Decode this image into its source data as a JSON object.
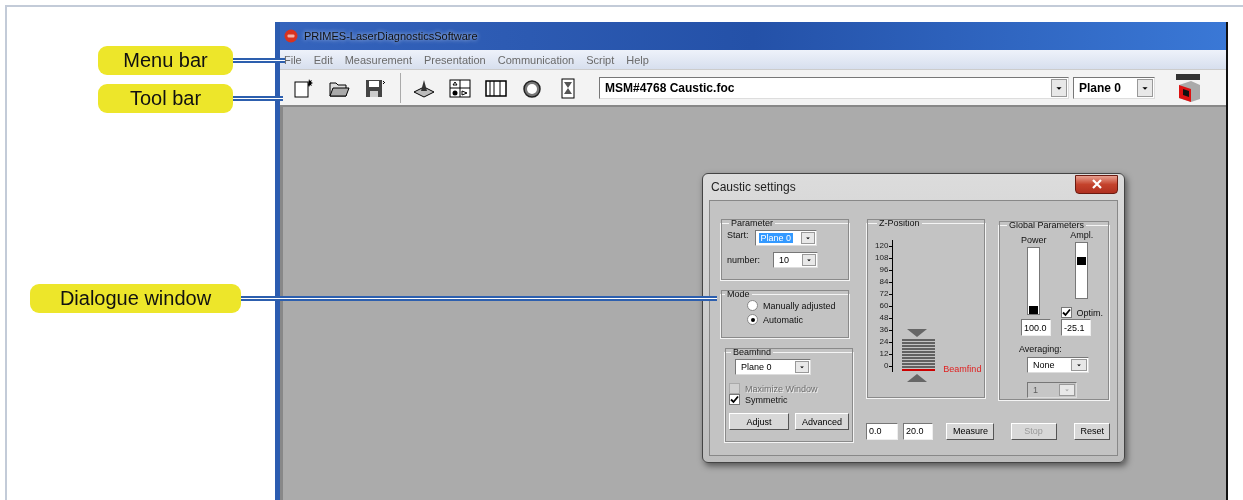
{
  "annotations": [
    {
      "label": "Menu bar"
    },
    {
      "label": "Tool bar"
    },
    {
      "label": "Dialogue window"
    }
  ],
  "app": {
    "title": "PRIMES-LaserDiagnosticsSoftware",
    "menu": [
      "File",
      "Edit",
      "Measurement",
      "Presentation",
      "Communication",
      "Script",
      "Help"
    ],
    "toolbar": {
      "file_field": "MSM#4768 Caustic.foc",
      "plane_select": "Plane 0"
    }
  },
  "dialog": {
    "title": "Caustic settings",
    "parameter": {
      "title": "Parameter",
      "start_label": "Start:",
      "start_value": "Plane 0",
      "start_focused": true,
      "number_label": "number:",
      "number_value": "10"
    },
    "mode": {
      "title": "Mode",
      "options": [
        {
          "label": "Manually adjusted",
          "selected": false
        },
        {
          "label": "Automatic",
          "selected": true
        }
      ]
    },
    "beamfind": {
      "title": "Beamfind",
      "select": "Plane 0",
      "checks": [
        {
          "label": "Maximize Window",
          "checked": false,
          "disabled": true
        },
        {
          "label": "Symmetric",
          "checked": true,
          "disabled": false
        }
      ],
      "buttons": [
        "Adjust",
        "Advanced"
      ]
    },
    "z_position": {
      "title": "Z-Position",
      "ticks": [
        "120",
        "108",
        "96",
        "84",
        "72",
        "60",
        "48",
        "36",
        "24",
        "12",
        "0"
      ],
      "marker_label": "Beamfind"
    },
    "global": {
      "title": "Global Parameters",
      "power": {
        "label": "Power",
        "level": 0,
        "value": "100.0"
      },
      "ampl": {
        "label": "Ampl.",
        "level": 0.7,
        "value": "-25.1"
      },
      "optim": {
        "label": "Optim.",
        "checked": true
      },
      "averaging_label": "Averaging:",
      "averaging": "None",
      "count": {
        "value": "1",
        "disabled": true
      }
    },
    "bottom": {
      "from": "0.0",
      "to": "20.0",
      "buttons": [
        {
          "label": "Measure",
          "disabled": false
        },
        {
          "label": "Stop",
          "disabled": true
        },
        {
          "label": "Reset",
          "disabled": false
        }
      ]
    }
  }
}
